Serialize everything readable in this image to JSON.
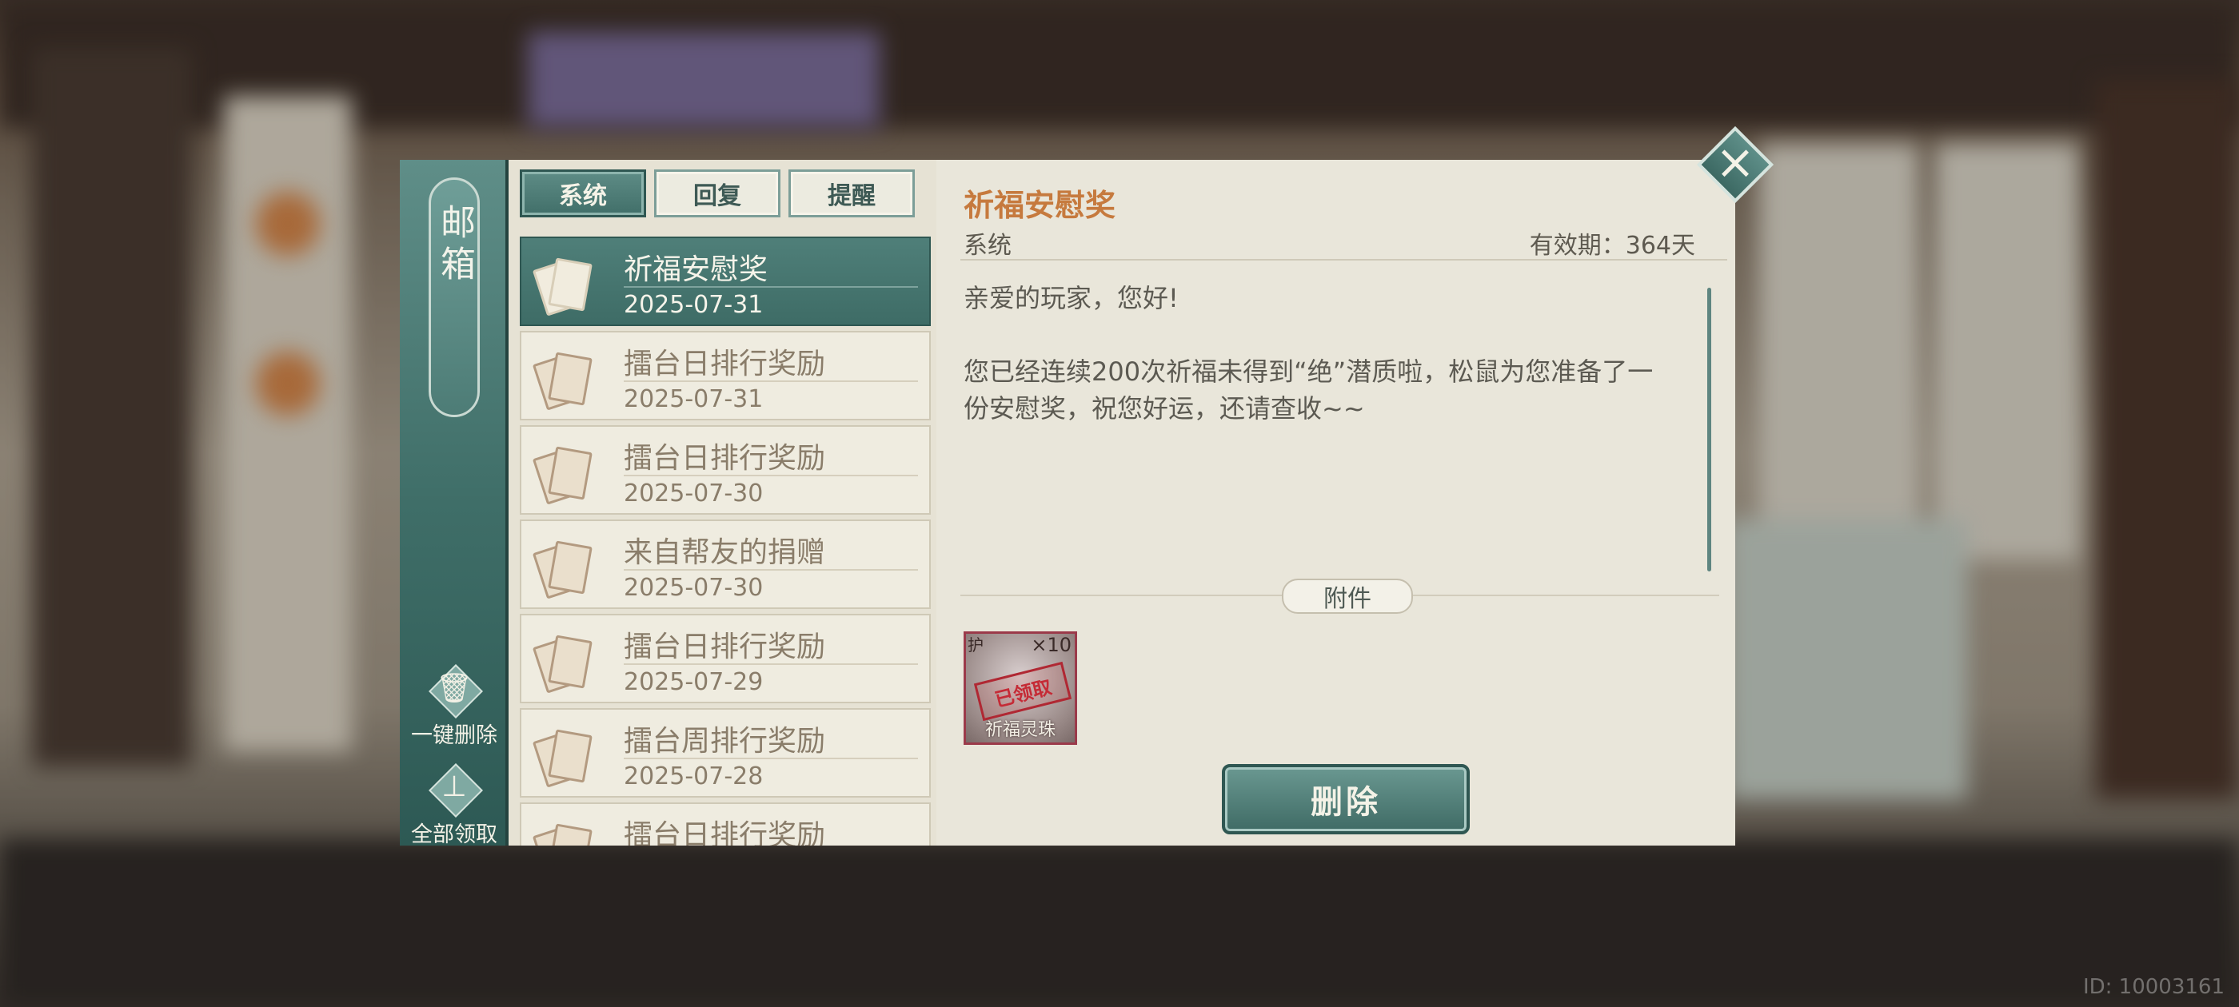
{
  "sidebar": {
    "title": "邮箱",
    "delete_all_label": "一键删除",
    "claim_all_label": "全部领取"
  },
  "tabs": [
    {
      "label": "系统",
      "active": true
    },
    {
      "label": "回复",
      "active": false
    },
    {
      "label": "提醒",
      "active": false
    }
  ],
  "mails": [
    {
      "subject": "祈福安慰奖",
      "date": "2025-07-31",
      "active": true
    },
    {
      "subject": "擂台日排行奖励",
      "date": "2025-07-31",
      "active": false
    },
    {
      "subject": "擂台日排行奖励",
      "date": "2025-07-30",
      "active": false
    },
    {
      "subject": "来自帮友的捐赠",
      "date": "2025-07-30",
      "active": false
    },
    {
      "subject": "擂台日排行奖励",
      "date": "2025-07-29",
      "active": false
    },
    {
      "subject": "擂台周排行奖励",
      "date": "2025-07-28",
      "active": false
    },
    {
      "subject": "擂台日排行奖励",
      "date": "",
      "active": false
    }
  ],
  "content": {
    "title": "祈福安慰奖",
    "sender": "系统",
    "validity": "有效期：364天",
    "greeting": "亲爱的玩家，您好!",
    "body": "您已经连续200次祈福未得到“绝”潜质啦，松鼠为您准备了一份安慰奖，祝您好运，还请查收~~",
    "attachment_label": "附件",
    "attachment": {
      "name": "祈福灵珠",
      "quantity": "×10",
      "corner_mark": "护",
      "stamp": "已领取"
    },
    "delete_label": "删除"
  },
  "close_icon": "×",
  "player_id": "ID: 10003161",
  "colors": {
    "accent_teal": "#416f69",
    "title_orange": "#c67a3e",
    "panel_bg": "#e9e6da",
    "stamp_red": "#c52b36"
  }
}
